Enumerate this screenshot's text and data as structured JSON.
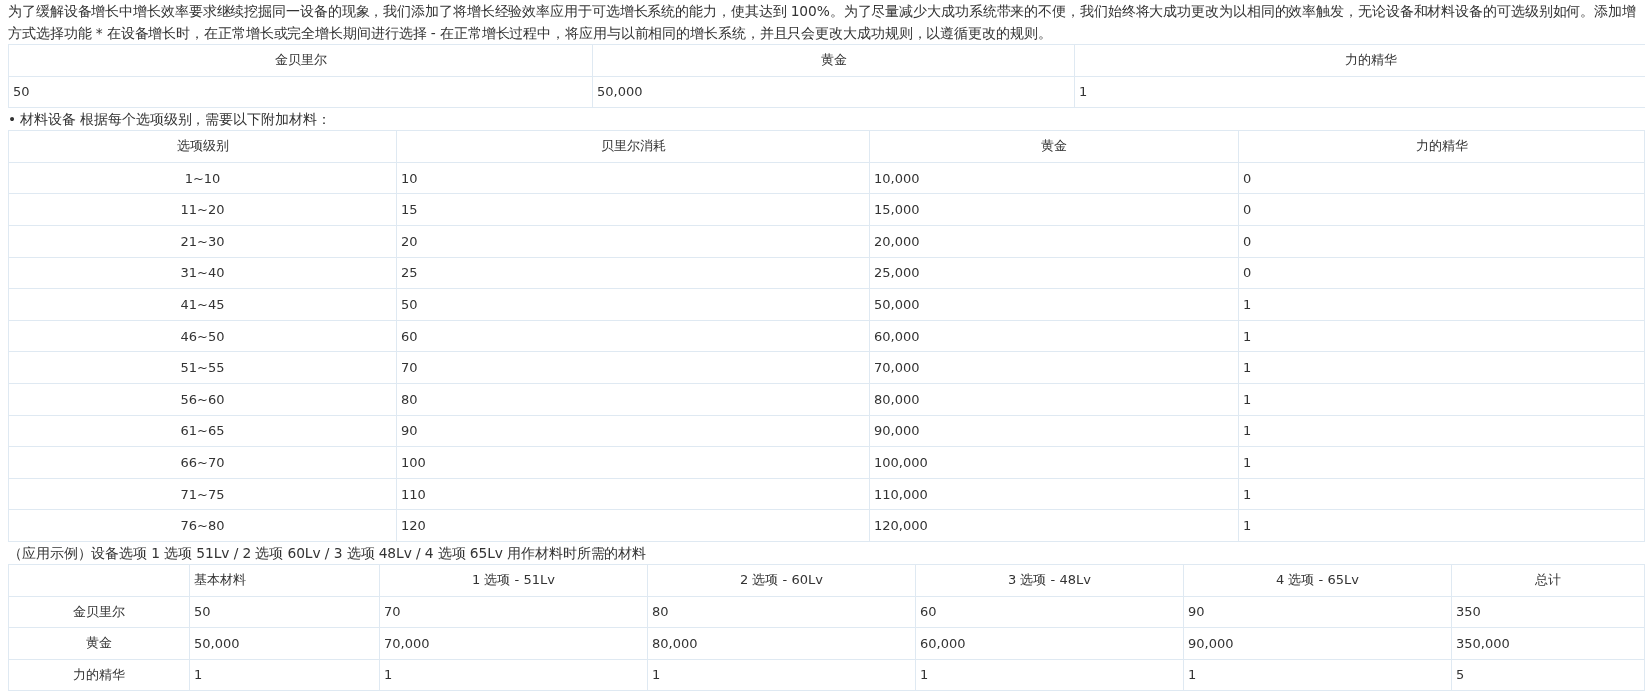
{
  "intro_lines": [
    "为了缓解设备增长中增长效率要求继续挖掘同一设备的现象，我们添加了将增长经验效率应用于可选增长系统的能力，使其达到 100%。为了尽量减少大成功系统带来的不便，我们始终将大成功更改为以相同的效率触发，无论设备和材料设备的可选级别如何。添加增",
    "方式选择功能 * 在设备增长时，在正常增长或完全增长期间进行选择 - 在正常增长过程中，将应用与以前相同的增长系统，并且只会更改大成功规则，以遵循更改的规则。"
  ],
  "base_table": {
    "columns": [
      "金贝里尔",
      "黄金",
      "力的精华"
    ],
    "rows": [
      [
        "50",
        "50,000",
        "1"
      ]
    ]
  },
  "materials_note": "• 材料设备 根据每个选项级别，需要以下附加材料：",
  "option_table": {
    "columns": [
      "选项级别",
      "贝里尔消耗",
      "黄金",
      "力的精华"
    ],
    "rows": [
      [
        "1~10",
        "10",
        "10,000",
        "0"
      ],
      [
        "11~20",
        "15",
        "15,000",
        "0"
      ],
      [
        "21~30",
        "20",
        "20,000",
        "0"
      ],
      [
        "31~40",
        "25",
        "25,000",
        "0"
      ],
      [
        "41~45",
        "50",
        "50,000",
        "1"
      ],
      [
        "46~50",
        "60",
        "60,000",
        "1"
      ],
      [
        "51~55",
        "70",
        "70,000",
        "1"
      ],
      [
        "56~60",
        "80",
        "80,000",
        "1"
      ],
      [
        "61~65",
        "90",
        "90,000",
        "1"
      ],
      [
        "66~70",
        "100",
        "100,000",
        "1"
      ],
      [
        "71~75",
        "110",
        "110,000",
        "1"
      ],
      [
        "76~80",
        "120",
        "120,000",
        "1"
      ]
    ]
  },
  "example_caption": "（应用示例）设备选项 1 选项 51Lv / 2 选项 60Lv / 3 选项 48Lv / 4 选项 65Lv 用作材料时所需的材料",
  "example_table": {
    "columns": [
      "",
      "基本材料",
      "1 选项 - 51Lv",
      "2 选项 - 60Lv",
      "3 选项 - 48Lv",
      "4 选项 - 65Lv",
      "总计"
    ],
    "rows": [
      [
        "金贝里尔",
        "50",
        "70",
        "80",
        "60",
        "90",
        "350"
      ],
      [
        "黄金",
        "50,000",
        "70,000",
        "80,000",
        "60,000",
        "90,000",
        "350,000"
      ],
      [
        "力的精华",
        "1",
        "1",
        "1",
        "1",
        "1",
        "5"
      ]
    ]
  }
}
